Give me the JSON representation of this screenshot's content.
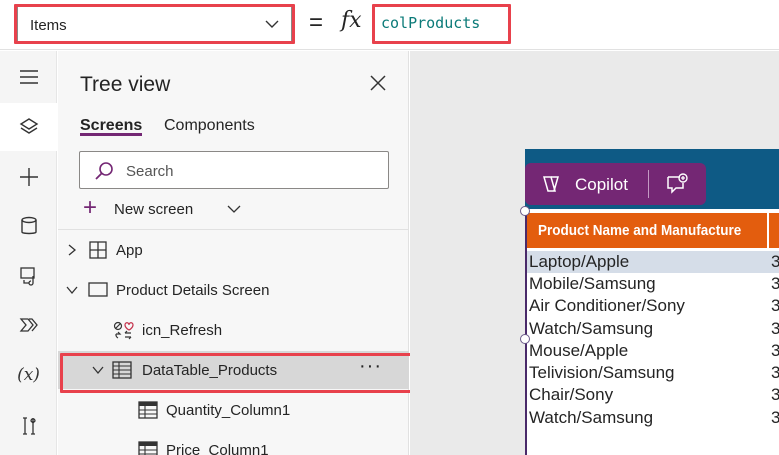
{
  "formula_bar": {
    "property": "Items",
    "equals": "=",
    "fx": "fx",
    "formula": "colProducts"
  },
  "rail": {
    "items": [
      "hamburger-icon",
      "layers-icon",
      "plus-icon",
      "database-icon",
      "media-icon",
      "power-automate-icon",
      "variables-icon",
      "tools-icon"
    ],
    "variables_label": "(x)"
  },
  "tree": {
    "title": "Tree view",
    "tabs": [
      "Screens",
      "Components"
    ],
    "search_placeholder": "Search",
    "new_screen": "New screen",
    "nodes": [
      {
        "label": "App"
      },
      {
        "label": "Product Details Screen"
      },
      {
        "label": "icn_Refresh"
      },
      {
        "label": "DataTable_Products",
        "more": "···"
      },
      {
        "label": "Quantity_Column1"
      },
      {
        "label": "Price_Column1"
      }
    ]
  },
  "canvas": {
    "copilot_label": "Copilot",
    "table": {
      "header": "Product Name and Manufacture",
      "rows": [
        {
          "c1": "Laptop/Apple",
          "c2": "3"
        },
        {
          "c1": "Mobile/Samsung",
          "c2": "3"
        },
        {
          "c1": "Air Conditioner/Sony",
          "c2": "3"
        },
        {
          "c1": "Watch/Samsung",
          "c2": "3"
        },
        {
          "c1": "Mouse/Apple",
          "c2": "3"
        },
        {
          "c1": "Telivision/Samsung",
          "c2": "3"
        },
        {
          "c1": "Chair/Sony",
          "c2": "3"
        },
        {
          "c1": "Watch/Samsung",
          "c2": "3"
        }
      ]
    }
  },
  "colors": {
    "accent": "#742774",
    "highlight": "#e8414c",
    "table_header": "#e35d0e",
    "app_header": "#0e5a85"
  }
}
